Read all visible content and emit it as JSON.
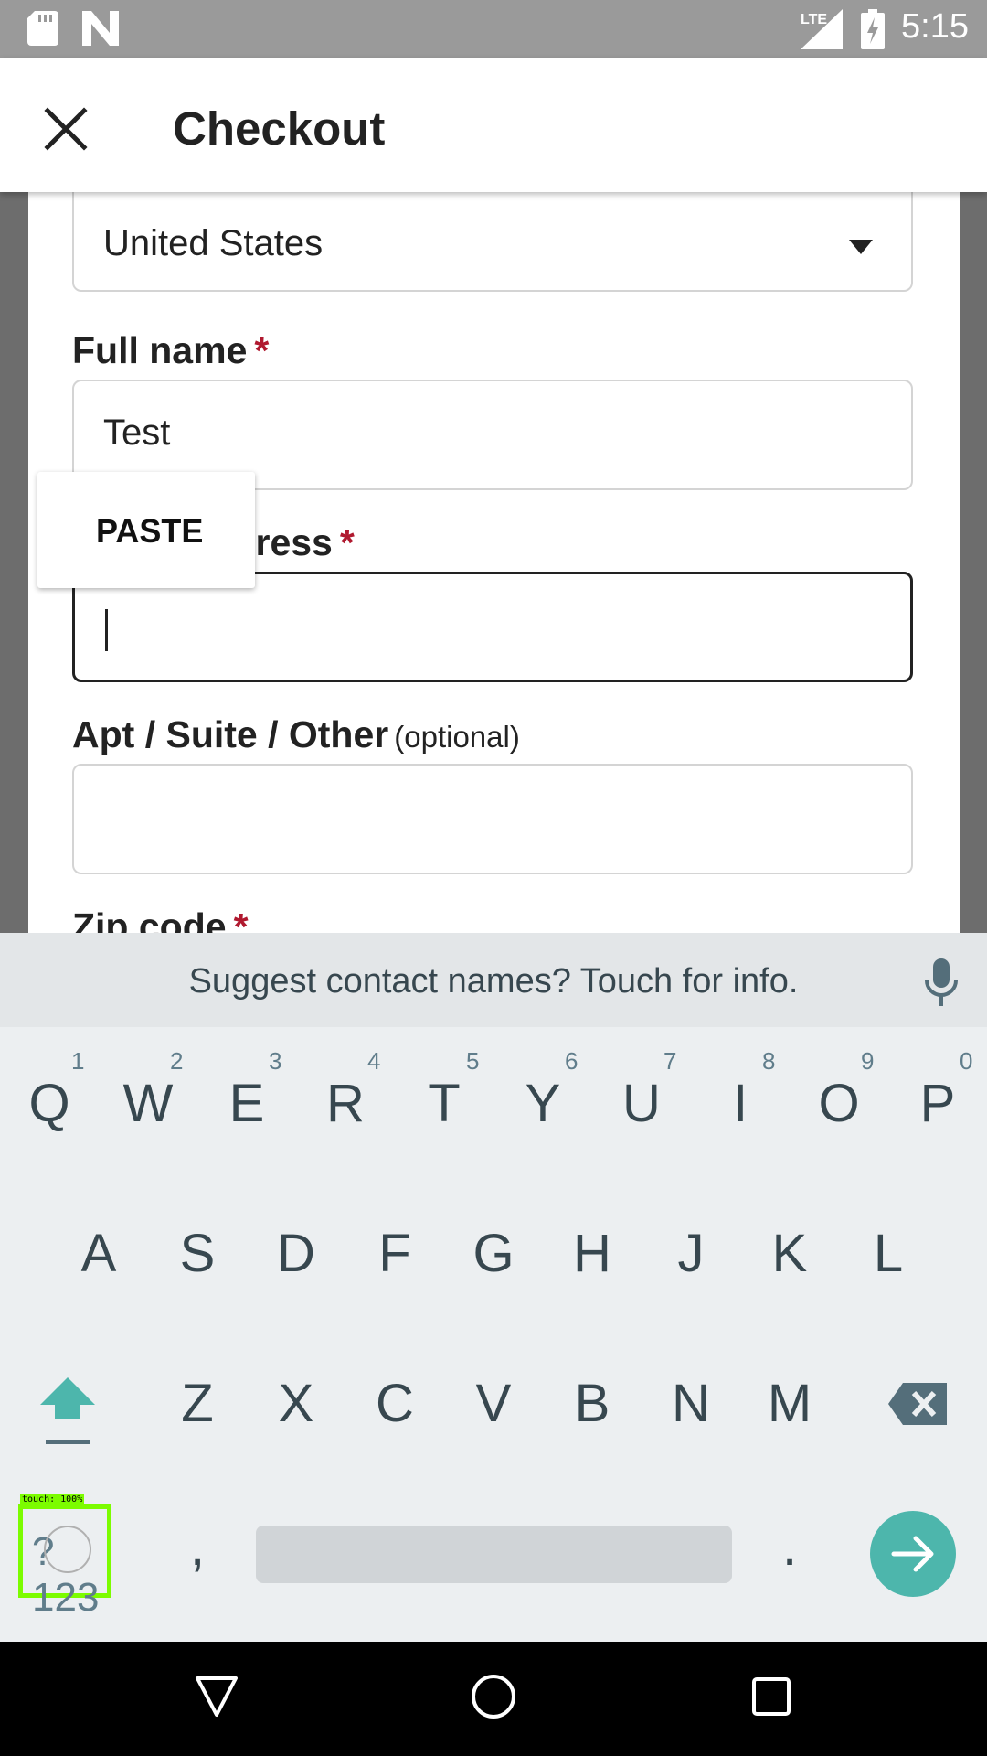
{
  "status_bar": {
    "time": "5:15",
    "network": "LTE",
    "icons": [
      "sd-card-icon",
      "n-notification-icon",
      "lte-signal-icon",
      "battery-charging-icon"
    ]
  },
  "header": {
    "title": "Checkout",
    "close_icon": "close-icon"
  },
  "form": {
    "country_value": "United States",
    "full_name_label": "Full name",
    "full_name_value": "Test",
    "street_label": "Street address",
    "street_value": "",
    "apt_label": "Apt / Suite / Other",
    "apt_optional": "(optional)",
    "apt_value": "",
    "zip_label": "Zip code",
    "required_mark": "*"
  },
  "paste_popup": {
    "label": "PASTE"
  },
  "keyboard": {
    "suggestion": "Suggest contact names? Touch for info.",
    "row1": [
      "Q",
      "W",
      "E",
      "R",
      "T",
      "Y",
      "U",
      "I",
      "O",
      "P"
    ],
    "row1_hints": [
      "1",
      "2",
      "3",
      "4",
      "5",
      "6",
      "7",
      "8",
      "9",
      "0"
    ],
    "row2": [
      "A",
      "S",
      "D",
      "F",
      "G",
      "H",
      "J",
      "K",
      "L"
    ],
    "row3": [
      "Z",
      "X",
      "C",
      "V",
      "B",
      "N",
      "M"
    ],
    "symbols_key": "?123",
    "comma": ",",
    "period": ".",
    "touch_overlay": "touch: 100%"
  },
  "colors": {
    "required": "#b0192f",
    "enter_key": "#4db6ac",
    "shift_key": "#4db6ac",
    "touch_highlight": "#7cfc00"
  }
}
